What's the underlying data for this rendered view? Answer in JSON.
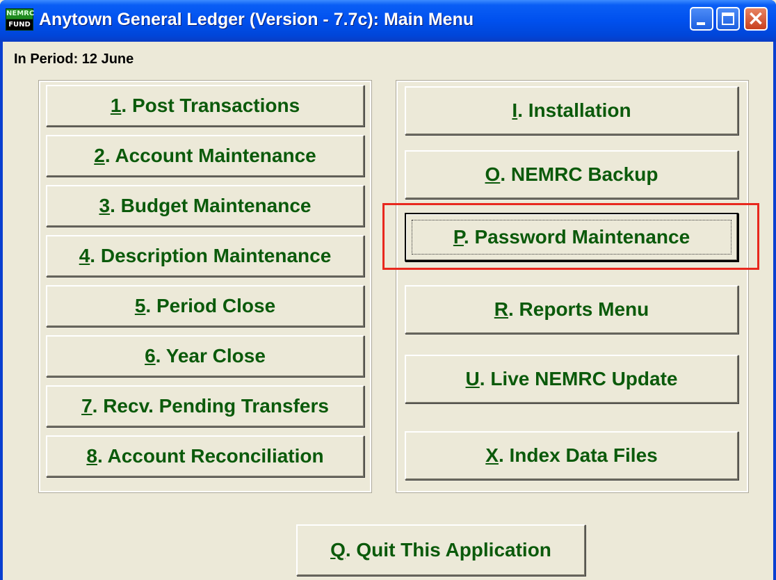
{
  "window": {
    "title": "Anytown General Ledger (Version - 7.7c):  Main Menu",
    "icon_top": "NEMRC",
    "icon_bottom": "FUND",
    "controls": [
      "minimize-icon",
      "maximize-icon",
      "close-icon"
    ]
  },
  "status": {
    "period": "In Period: 12 June"
  },
  "left_menu": [
    {
      "key": "1",
      "rest": ".  Post Transactions"
    },
    {
      "key": "2",
      "rest": ". Account Maintenance"
    },
    {
      "key": "3",
      "rest": ". Budget Maintenance"
    },
    {
      "key": "4",
      "rest": ". Description Maintenance"
    },
    {
      "key": "5",
      "rest": ". Period Close"
    },
    {
      "key": "6",
      "rest": ". Year Close"
    },
    {
      "key": "7",
      "rest": ". Recv. Pending Transfers"
    },
    {
      "key": "8",
      "rest": ". Account Reconciliation"
    }
  ],
  "right_menu": [
    {
      "key": "I",
      "rest": ".  Installation"
    },
    {
      "key": "O",
      "rest": ". NEMRC Backup"
    },
    {
      "key": "P",
      "rest": ".  Password Maintenance",
      "focused": true,
      "highlighted": true
    },
    {
      "key": "R",
      "rest": ".  Reports Menu"
    },
    {
      "key": "U",
      "rest": ". Live NEMRC Update"
    },
    {
      "key": "X",
      "rest": ".  Index Data Files"
    }
  ],
  "quit": {
    "key": "Q",
    "rest": ".  Quit This Application"
  },
  "colors": {
    "title_bar": "#0050ee",
    "button_text": "#0b5a0b",
    "face": "#ece9d8",
    "highlight": "#e8281e"
  }
}
